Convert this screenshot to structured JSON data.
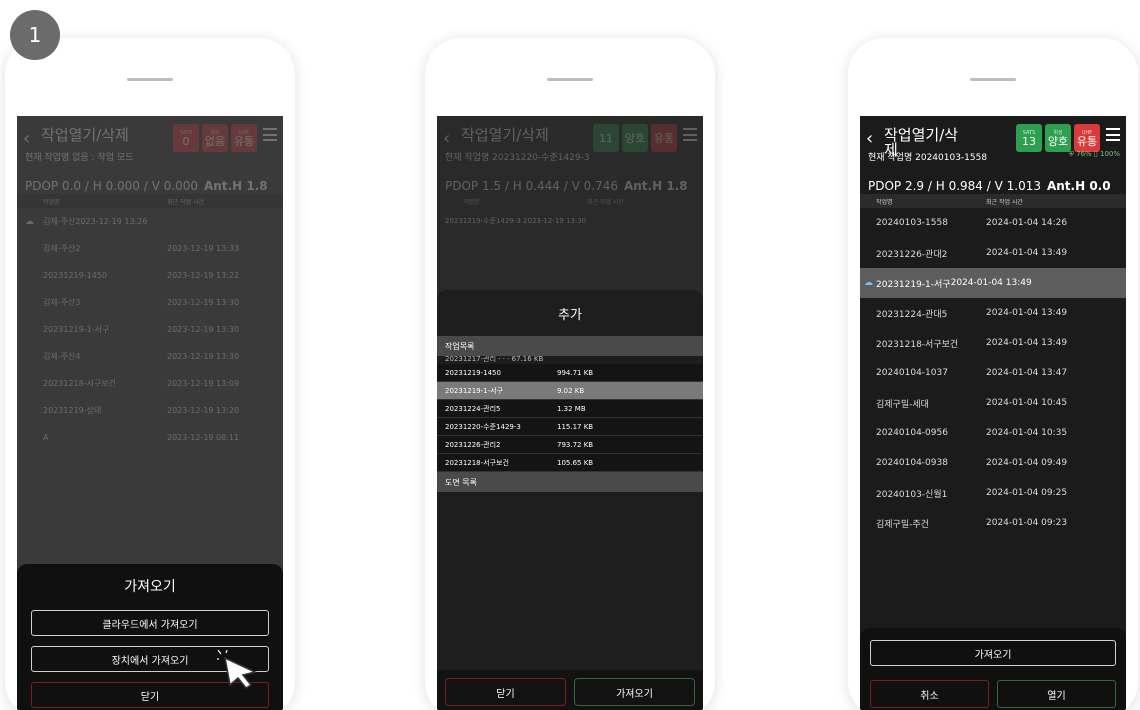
{
  "step": {
    "number": "1"
  },
  "colors": {
    "green": "#2e9e4f",
    "red": "#d93a3a",
    "selected": "#5d5d5d"
  },
  "phone1": {
    "title": "작업열기/삭제",
    "current": "현재 작업명 없음 : 작업 모드",
    "pdop": "PDOP 0.0 / H 0.000 / V 0.000",
    "ant": "Ant.H 1.8",
    "col_name": "작업명",
    "col_time": "최근 작업 시간",
    "rows": [
      {
        "name": "김제-주산",
        "time": "2023-12-19 13:26"
      },
      {
        "name": "김제-주산2",
        "time": "2023-12-19 13:33"
      },
      {
        "name": "20231219-1450",
        "time": "2023-12-19 13:22"
      },
      {
        "name": "김제-주산3",
        "time": "2023-12-19 13:30"
      },
      {
        "name": "20231219-1-서구",
        "time": "2023-12-19 13:30"
      },
      {
        "name": "김제-주산4",
        "time": "2023-12-19 13:30"
      },
      {
        "name": "20231218-서구보건",
        "time": "2023-12-19 13:09"
      },
      {
        "name": "20231219-상태",
        "time": "2023-12-19 13:20"
      },
      {
        "name": "A",
        "time": "2023-12-19 08:11"
      }
    ],
    "sheet_title": "가져오기",
    "btn_cloud": "클라우드에서 가져오기",
    "btn_device": "장치에서 가져오기",
    "btn_close": "닫기"
  },
  "phone2": {
    "title": "작업열기/삭제",
    "current": "현재 작업명 20231220-수준1429-3",
    "pdop": "PDOP 1.5 / H 0.444 / V 0.746",
    "ant": "Ant.H 1.8",
    "ghost": "20231219-수준1429-3 2023-12-19 13:30",
    "modal_title": "추가",
    "section_work": "작업목록",
    "files": [
      {
        "name": "20231219-1450",
        "size": "994.71 KB"
      },
      {
        "name": "20231219-1-서구",
        "size": "9.02 KB"
      },
      {
        "name": "20231224-관리5",
        "size": "1.32 MB"
      },
      {
        "name": "20231220-수준1429-3",
        "size": "115.17 KB"
      },
      {
        "name": "20231226-관리2",
        "size": "793.72 KB"
      },
      {
        "name": "20231218-서구보건",
        "size": "105.65 KB"
      }
    ],
    "section_drawing": "도면 목록",
    "btn_close": "닫기",
    "btn_import": "가져오기"
  },
  "phone3": {
    "title": "작업열기/삭제",
    "badge1_top": "SATS",
    "badge1": "13",
    "badge2_top": "위성",
    "badge2": "양호",
    "badge3_top": "UHF",
    "badge3": "유통",
    "current": "현재 작업명 20240103-1558",
    "battery1": "76%",
    "battery2": "100%",
    "pdop": "PDOP 2.9 / H 0.984 / V 1.013",
    "ant": "Ant.H 0.0",
    "col_name": "작업명",
    "col_time": "최근 작업 시간",
    "rows": [
      {
        "name": "20240103-1558",
        "time": "2024-01-04 14:26"
      },
      {
        "name": "20231226-관대2",
        "time": "2024-01-04 13:49"
      },
      {
        "name": "20231219-1-서구",
        "time": "2024-01-04 13:49"
      },
      {
        "name": "20231224-관대5",
        "time": "2024-01-04 13:49"
      },
      {
        "name": "20231218-서구보건",
        "time": "2024-01-04 13:49"
      },
      {
        "name": "20240104-1037",
        "time": "2024-01-04 13:47"
      },
      {
        "name": "김제구밀-세대",
        "time": "2024-01-04 10:45"
      },
      {
        "name": "20240104-0956",
        "time": "2024-01-04 10:35"
      },
      {
        "name": "20240104-0938",
        "time": "2024-01-04 09:49"
      },
      {
        "name": "20240103-신월1",
        "time": "2024-01-04 09:25"
      },
      {
        "name": "김제구밀-주건",
        "time": "2024-01-04 09:23"
      }
    ],
    "btn_import": "가져오기",
    "btn_cancel": "취소",
    "btn_open": "열기"
  }
}
